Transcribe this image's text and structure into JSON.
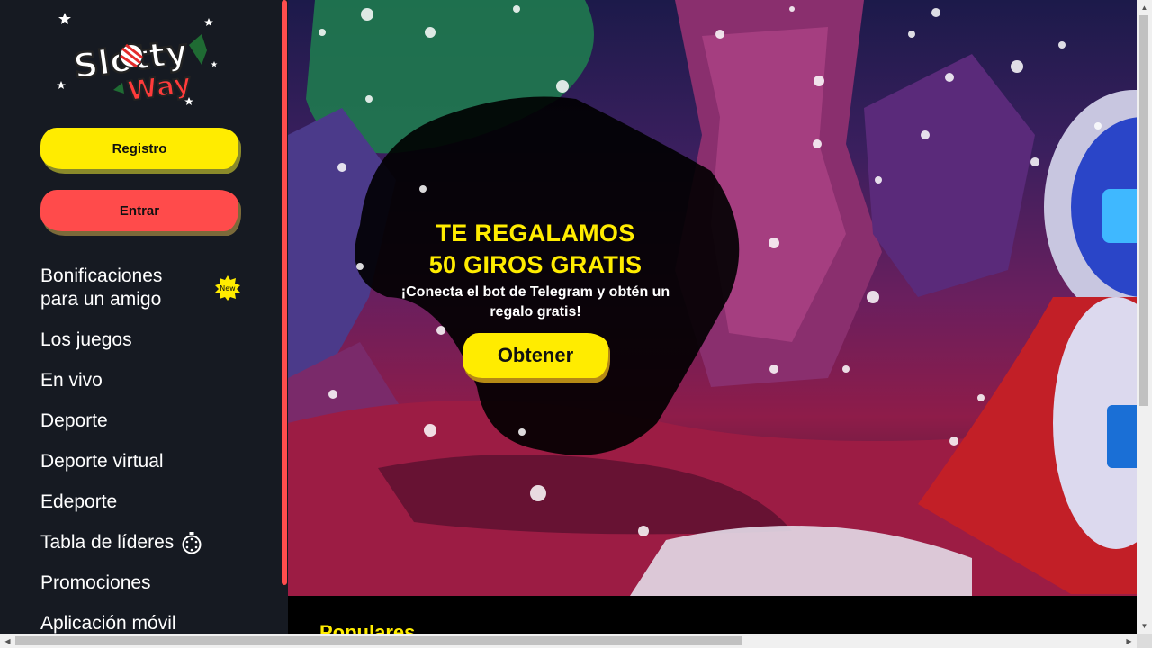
{
  "brand": {
    "logo_line1": "Slotty",
    "logo_line2": "Way"
  },
  "auth": {
    "register_label": "Registro",
    "login_label": "Entrar"
  },
  "nav": {
    "items": [
      {
        "label": "Bonificaciones\npara un amigo",
        "badge": "New"
      },
      {
        "label": "Los juegos"
      },
      {
        "label": "En vivo"
      },
      {
        "label": "Deporte"
      },
      {
        "label": "Deporte virtual"
      },
      {
        "label": "Edeporte"
      },
      {
        "label": "Tabla de líderes",
        "icon": "stopwatch-icon"
      },
      {
        "label": "Promociones"
      },
      {
        "label": "Aplicación móvil"
      }
    ]
  },
  "promo": {
    "line1": "TE REGALAMOS",
    "line2": "50 GIROS GRATIS",
    "subtitle": "¡Conecta el bot de Telegram y obtén un regalo gratis!",
    "button_label": "Obtener"
  },
  "section": {
    "title": "Populares"
  },
  "colors": {
    "sidebar_bg": "#161a22",
    "accent_yellow": "#ffec00",
    "accent_red": "#ff4b4b"
  }
}
